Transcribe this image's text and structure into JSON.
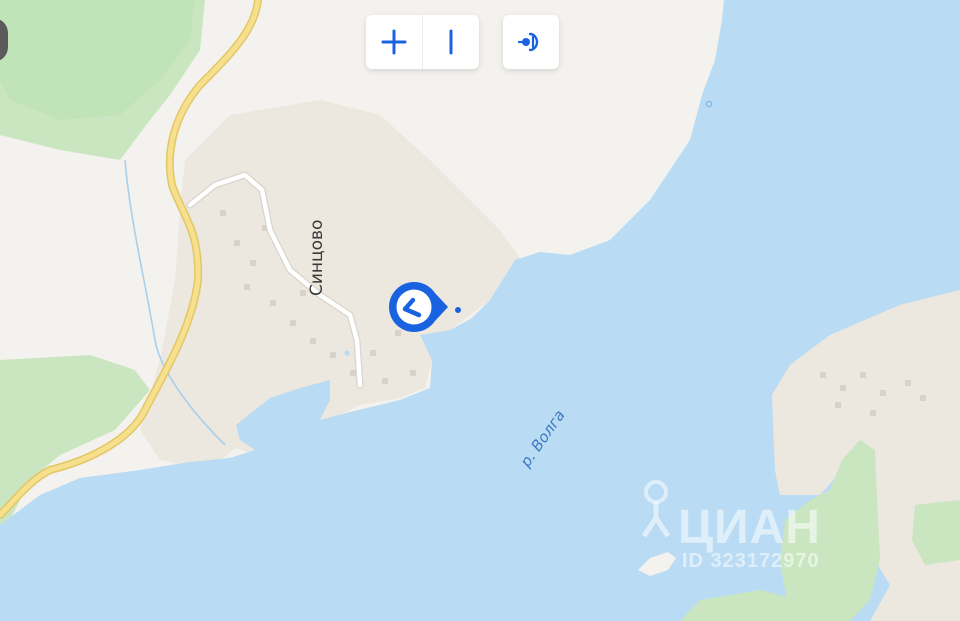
{
  "map": {
    "colors": {
      "land": "#f4f2ee",
      "land_warm": "#ece7df",
      "water": "#b9dbf3",
      "forest": "#c9e6c0",
      "forest_dark": "#b5dcaa",
      "road_yellow": "#f3da7f",
      "road_white": "#ffffff",
      "accent": "#1a63e0"
    },
    "village_label": "Синцово",
    "river_label": "р. Волга"
  },
  "controls": {
    "zoom_in_icon": "plus-icon",
    "zoom_out_icon": "minus-icon",
    "locate_icon": "locate-icon"
  },
  "marker": {
    "icon": "map-pin-marker-icon"
  },
  "watermark": {
    "brand": "ЦИАН",
    "id": "ID 323172970"
  }
}
